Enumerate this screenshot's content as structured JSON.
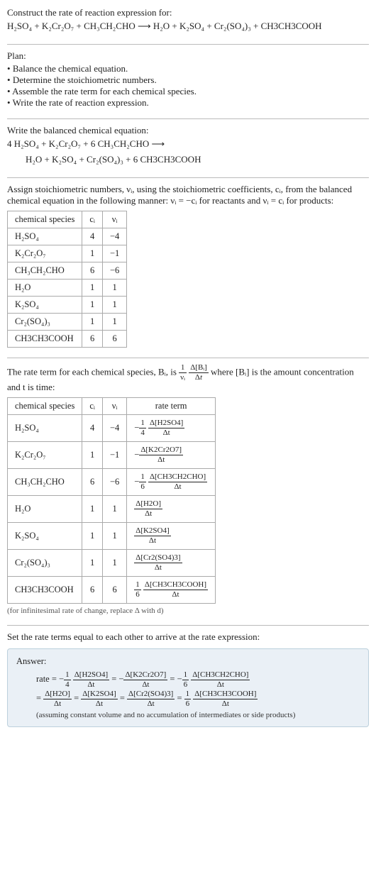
{
  "intro": {
    "line1": "Construct the rate of reaction expression for:",
    "equation": "H₂SO₄ + K₂Cr₂O₇ + CH₃CH₂CHO  ⟶  H₂O + K₂SO₄ + Cr₂(SO₄)₃ + CH3CH3COOH"
  },
  "plan": {
    "heading": "Plan:",
    "items": [
      "Balance the chemical equation.",
      "Determine the stoichiometric numbers.",
      "Assemble the rate term for each chemical species.",
      "Write the rate of reaction expression."
    ]
  },
  "balanced": {
    "heading": "Write the balanced chemical equation:",
    "line1": "4 H₂SO₄ + K₂Cr₂O₇ + 6 CH₃CH₂CHO ⟶",
    "line2": "H₂O + K₂SO₄ + Cr₂(SO₄)₃ + 6 CH3CH3COOH"
  },
  "stoich_intro": "Assign stoichiometric numbers, νᵢ, using the stoichiometric coefficients, cᵢ, from the balanced chemical equation in the following manner: νᵢ = −cᵢ for reactants and νᵢ = cᵢ for products:",
  "table1": {
    "headers": [
      "chemical species",
      "cᵢ",
      "νᵢ"
    ],
    "rows": [
      [
        "H₂SO₄",
        "4",
        "−4"
      ],
      [
        "K₂Cr₂O₇",
        "1",
        "−1"
      ],
      [
        "CH₃CH₂CHO",
        "6",
        "−6"
      ],
      [
        "H₂O",
        "1",
        "1"
      ],
      [
        "K₂SO₄",
        "1",
        "1"
      ],
      [
        "Cr₂(SO₄)₃",
        "1",
        "1"
      ],
      [
        "CH3CH3COOH",
        "6",
        "6"
      ]
    ]
  },
  "rate_term_intro_1": "The rate term for each chemical species, Bᵢ, is ",
  "rate_term_intro_2": " where [Bᵢ] is the amount concentration and t is time:",
  "table2": {
    "headers": [
      "chemical species",
      "cᵢ",
      "νᵢ",
      "rate term"
    ],
    "rows": [
      {
        "species": "H₂SO₄",
        "c": "4",
        "v": "−4",
        "neg": "−",
        "coef_num": "1",
        "coef_den": "4",
        "delta": "Δ[H2SO4]"
      },
      {
        "species": "K₂Cr₂O₇",
        "c": "1",
        "v": "−1",
        "neg": "−",
        "coef_num": "",
        "coef_den": "",
        "delta": "Δ[K2Cr2O7]"
      },
      {
        "species": "CH₃CH₂CHO",
        "c": "6",
        "v": "−6",
        "neg": "−",
        "coef_num": "1",
        "coef_den": "6",
        "delta": "Δ[CH3CH2CHO]"
      },
      {
        "species": "H₂O",
        "c": "1",
        "v": "1",
        "neg": "",
        "coef_num": "",
        "coef_den": "",
        "delta": "Δ[H2O]"
      },
      {
        "species": "K₂SO₄",
        "c": "1",
        "v": "1",
        "neg": "",
        "coef_num": "",
        "coef_den": "",
        "delta": "Δ[K2SO4]"
      },
      {
        "species": "Cr₂(SO₄)₃",
        "c": "1",
        "v": "1",
        "neg": "",
        "coef_num": "",
        "coef_den": "",
        "delta": "Δ[Cr2(SO4)3]"
      },
      {
        "species": "CH3CH3COOH",
        "c": "6",
        "v": "6",
        "neg": "",
        "coef_num": "1",
        "coef_den": "6",
        "delta": "Δ[CH3CH3COOH]"
      }
    ]
  },
  "infinitesimal_note": "(for infinitesimal rate of change, replace Δ with d)",
  "set_equal": "Set the rate terms equal to each other to arrive at the rate expression:",
  "answer": {
    "label": "Answer:",
    "line1_prefix": "rate = ",
    "terms": [
      {
        "neg": "−",
        "coef_num": "1",
        "coef_den": "4",
        "delta": "Δ[H2SO4]"
      },
      {
        "neg": "−",
        "coef_num": "",
        "coef_den": "",
        "delta": "Δ[K2Cr2O7]"
      },
      {
        "neg": "−",
        "coef_num": "1",
        "coef_den": "6",
        "delta": "Δ[CH3CH2CHO]"
      },
      {
        "neg": "",
        "coef_num": "",
        "coef_den": "",
        "delta": "Δ[H2O]"
      },
      {
        "neg": "",
        "coef_num": "",
        "coef_den": "",
        "delta": "Δ[K2SO4]"
      },
      {
        "neg": "",
        "coef_num": "",
        "coef_den": "",
        "delta": "Δ[Cr2(SO4)3]"
      },
      {
        "neg": "",
        "coef_num": "1",
        "coef_den": "6",
        "delta": "Δ[CH3CH3COOH]"
      }
    ],
    "note": "(assuming constant volume and no accumulation of intermediates or side products)"
  },
  "dt": "Δt"
}
